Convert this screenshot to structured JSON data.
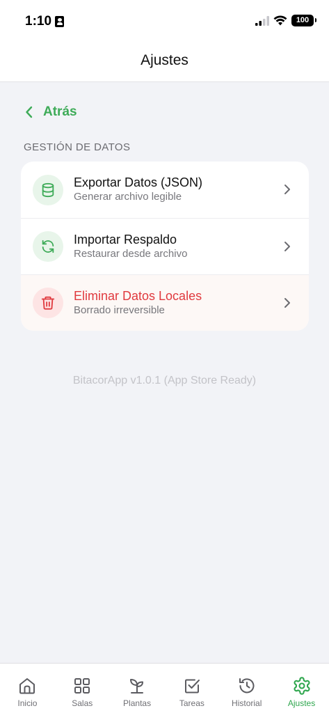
{
  "status_bar": {
    "time": "1:10",
    "battery": "100"
  },
  "header": {
    "title": "Ajustes"
  },
  "back": {
    "label": "Atrás"
  },
  "section": {
    "title": "GESTIÓN DE DATOS"
  },
  "rows": [
    {
      "title": "Exportar Datos (JSON)",
      "subtitle": "Generar archivo legible",
      "icon": "database-icon"
    },
    {
      "title": "Importar Respaldo",
      "subtitle": "Restaurar desde archivo",
      "icon": "refresh-icon"
    },
    {
      "title": "Eliminar Datos Locales",
      "subtitle": "Borrado irreversible",
      "icon": "trash-icon"
    }
  ],
  "version": "BitacorApp v1.0.1 (App Store Ready)",
  "tabs": [
    {
      "label": "Inicio",
      "icon": "home-icon"
    },
    {
      "label": "Salas",
      "icon": "grid-icon"
    },
    {
      "label": "Plantas",
      "icon": "sprout-icon"
    },
    {
      "label": "Tareas",
      "icon": "checkbox-icon"
    },
    {
      "label": "Historial",
      "icon": "history-icon"
    },
    {
      "label": "Ajustes",
      "icon": "gear-icon",
      "active": true
    }
  ],
  "colors": {
    "accent": "#3eab58",
    "danger": "#e0393e",
    "background": "#f2f3f7"
  }
}
